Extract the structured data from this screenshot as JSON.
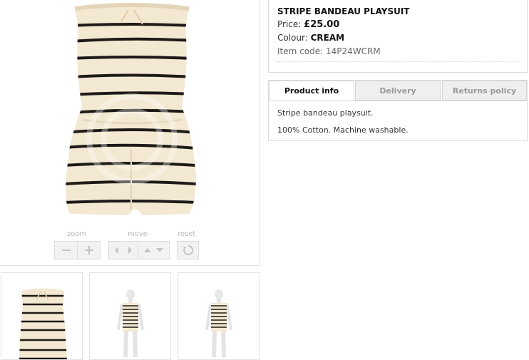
{
  "product": {
    "name": "STRIPE BANDEAU PLAYSUIT",
    "price_label": "Price:",
    "price": "£25.00",
    "colour_label": "Colour:",
    "colour": "CREAM",
    "item_code_label": "Item code:",
    "item_code": "14P24WCRM"
  },
  "viewer": {
    "zoom_label": "zoom",
    "move_label": "move",
    "reset_label": "reset",
    "icons": [
      "minus-icon",
      "plus-icon",
      "arrow-left-icon",
      "arrow-right-icon",
      "arrow-up-icon",
      "arrow-down-icon",
      "reset-icon"
    ]
  },
  "tabs": [
    {
      "label": "Product info",
      "active": true
    },
    {
      "label": "Delivery",
      "active": false
    },
    {
      "label": "Returns policy",
      "active": false
    }
  ],
  "tab_content": {
    "line1": "Stripe bandeau playsuit.",
    "line2": "100% Cotton. Machine washable."
  },
  "colors": {
    "fabric": "#f3e8d1",
    "stripe": "#1e1a17",
    "border": "#dcdcdc",
    "inactive_tab": "#efefef"
  }
}
